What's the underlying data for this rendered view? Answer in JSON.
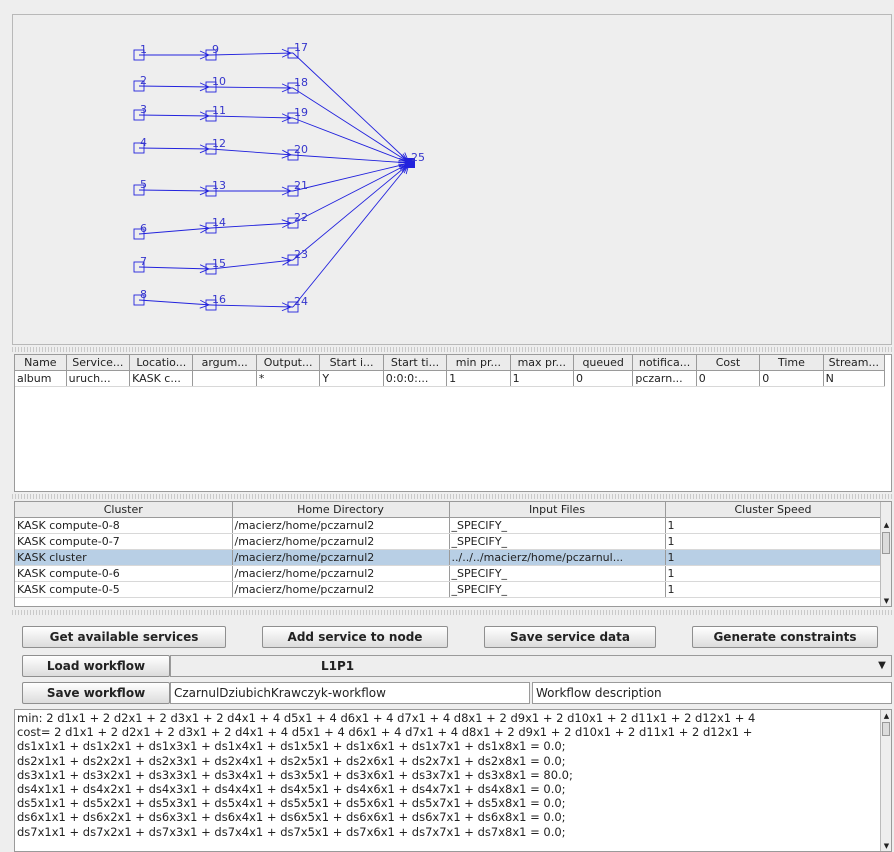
{
  "graph": {
    "nodes": [
      {
        "id": "1",
        "label": "1"
      },
      {
        "id": "2",
        "label": "2"
      },
      {
        "id": "3",
        "label": "3"
      },
      {
        "id": "4",
        "label": "4"
      },
      {
        "id": "5",
        "label": "5"
      },
      {
        "id": "6",
        "label": "6"
      },
      {
        "id": "7",
        "label": "7"
      },
      {
        "id": "8",
        "label": "8"
      },
      {
        "id": "9",
        "label": "9"
      },
      {
        "id": "10",
        "label": "10"
      },
      {
        "id": "11",
        "label": "11"
      },
      {
        "id": "12",
        "label": "12"
      },
      {
        "id": "13",
        "label": "13"
      },
      {
        "id": "14",
        "label": "14"
      },
      {
        "id": "15",
        "label": "15"
      },
      {
        "id": "16",
        "label": "16"
      },
      {
        "id": "17",
        "label": "17"
      },
      {
        "id": "18",
        "label": "18"
      },
      {
        "id": "19",
        "label": "19"
      },
      {
        "id": "20",
        "label": "20"
      },
      {
        "id": "21",
        "label": "21"
      },
      {
        "id": "22",
        "label": "22"
      },
      {
        "id": "23",
        "label": "23"
      },
      {
        "id": "24",
        "label": "24"
      },
      {
        "id": "25",
        "label": "25"
      }
    ],
    "edges": [
      [
        "1",
        "9"
      ],
      [
        "2",
        "10"
      ],
      [
        "3",
        "11"
      ],
      [
        "4",
        "12"
      ],
      [
        "5",
        "13"
      ],
      [
        "6",
        "14"
      ],
      [
        "7",
        "15"
      ],
      [
        "8",
        "16"
      ],
      [
        "9",
        "17"
      ],
      [
        "10",
        "18"
      ],
      [
        "11",
        "19"
      ],
      [
        "12",
        "20"
      ],
      [
        "13",
        "21"
      ],
      [
        "14",
        "22"
      ],
      [
        "15",
        "23"
      ],
      [
        "16",
        "24"
      ],
      [
        "17",
        "25"
      ],
      [
        "18",
        "25"
      ],
      [
        "19",
        "25"
      ],
      [
        "20",
        "25"
      ],
      [
        "21",
        "25"
      ],
      [
        "22",
        "25"
      ],
      [
        "23",
        "25"
      ],
      [
        "24",
        "25"
      ]
    ],
    "edge_color": "#2222dd",
    "label_color": "#3535cc"
  },
  "services_table": {
    "headers": [
      "Name",
      "Service...",
      "Locatio...",
      "argum...",
      "Output...",
      "Start i...",
      "Start ti...",
      "min pr...",
      "max pr...",
      "queued",
      "notifica...",
      "Cost",
      "Time",
      "Stream..."
    ],
    "rows": [
      [
        "album",
        "uruch...",
        "KASK c...",
        "",
        "*",
        "Y",
        "0:0:0:...",
        "1",
        "1",
        "0",
        "pczarn...",
        "0",
        "0",
        "N"
      ]
    ]
  },
  "cluster_table": {
    "headers": [
      "Cluster",
      "Home Directory",
      "Input Files",
      "Cluster Speed"
    ],
    "rows": [
      [
        "KASK compute-0-8",
        "/macierz/home/pczarnul2",
        "_SPECIFY_",
        "1"
      ],
      [
        "KASK compute-0-7",
        "/macierz/home/pczarnul2",
        "_SPECIFY_",
        "1"
      ],
      [
        "KASK cluster",
        "/macierz/home/pczarnul2",
        "../../../macierz/home/pczarnul...",
        "1"
      ],
      [
        "KASK compute-0-6",
        "/macierz/home/pczarnul2",
        "_SPECIFY_",
        "1"
      ],
      [
        "KASK compute-0-5",
        "/macierz/home/pczarnul2",
        "_SPECIFY_",
        "1"
      ]
    ],
    "selected_row": 2,
    "selection_color": "#b8cfe5"
  },
  "buttons": {
    "get_services": "Get available services",
    "add_service": "Add service to node",
    "save_service": "Save service data",
    "generate": "Generate constraints",
    "load_workflow": "Load workflow",
    "save_workflow": "Save workflow"
  },
  "workflow": {
    "selected": "L1P1",
    "name": "CzarnulDziubichKrawczyk-workflow",
    "description": "Workflow description"
  },
  "constraints": {
    "lines": [
      "min: 2 d1x1 + 2 d2x1 + 2 d3x1 + 2 d4x1 + 4 d5x1 + 4 d6x1 + 4 d7x1 + 4 d8x1 + 2 d9x1 + 2 d10x1 + 2 d11x1 + 2 d12x1 + 4",
      "cost= 2 d1x1 + 2 d2x1 + 2 d3x1 + 2 d4x1 + 4 d5x1 + 4 d6x1 + 4 d7x1 + 4 d8x1 + 2 d9x1 + 2 d10x1 + 2 d11x1 + 2 d12x1 +",
      "ds1x1x1 + ds1x2x1 + ds1x3x1 + ds1x4x1 + ds1x5x1 + ds1x6x1 + ds1x7x1 + ds1x8x1 = 0.0;",
      "ds2x1x1 + ds2x2x1 + ds2x3x1 + ds2x4x1 + ds2x5x1 + ds2x6x1 + ds2x7x1 + ds2x8x1 = 0.0;",
      "ds3x1x1 + ds3x2x1 + ds3x3x1 + ds3x4x1 + ds3x5x1 + ds3x6x1 + ds3x7x1 + ds3x8x1 = 80.0;",
      "ds4x1x1 + ds4x2x1 + ds4x3x1 + ds4x4x1 + ds4x5x1 + ds4x6x1 + ds4x7x1 + ds4x8x1 = 0.0;",
      "ds5x1x1 + ds5x2x1 + ds5x3x1 + ds5x4x1 + ds5x5x1 + ds5x6x1 + ds5x7x1 + ds5x8x1 = 0.0;",
      "ds6x1x1 + ds6x2x1 + ds6x3x1 + ds6x4x1 + ds6x5x1 + ds6x6x1 + ds6x7x1 + ds6x8x1 = 0.0;",
      "ds7x1x1 + ds7x2x1 + ds7x3x1 + ds7x4x1 + ds7x5x1 + ds7x6x1 + ds7x7x1 + ds7x8x1 = 0.0;"
    ]
  },
  "icons": {
    "scroll_up": "▲",
    "scroll_down": "▼",
    "combo_arrow": "▼"
  }
}
